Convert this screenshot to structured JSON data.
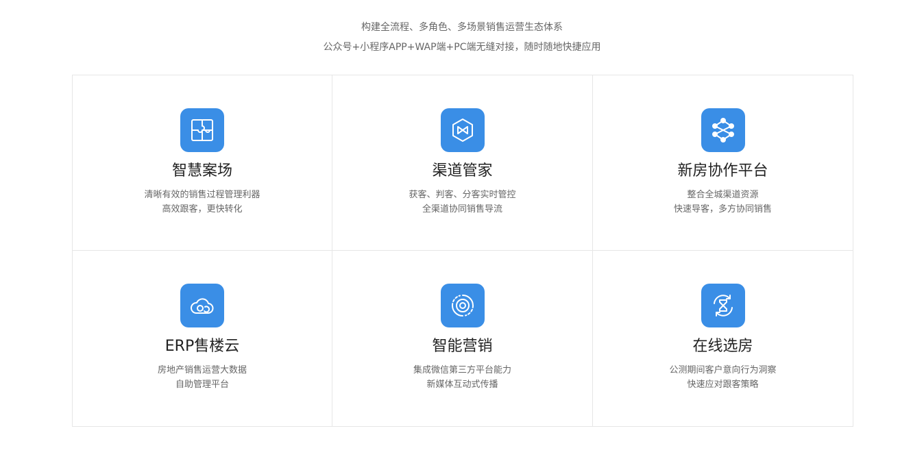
{
  "intro": {
    "line1": "构建全流程、多角色、多场景销售运营生态体系",
    "line2": "公众号+小程序APP+WAP端+PC端无缝对接，随时随地快捷应用"
  },
  "colors": {
    "accent": "#3a8ee6",
    "border": "#e6e6e6",
    "title": "#222222",
    "text": "#666666"
  },
  "features": [
    {
      "icon": "puzzle-icon",
      "title": "智慧案场",
      "desc": [
        "清晰有效的销售过程管理利器",
        "高效跟客，更快转化"
      ]
    },
    {
      "icon": "bow-tie-hexagon-icon",
      "title": "渠道管家",
      "desc": [
        "获客、判客、分客实时管控",
        "全渠道协同销售导流"
      ]
    },
    {
      "icon": "network-nodes-icon",
      "title": "新房协作平台",
      "desc": [
        "整合全城渠道资源",
        "快速导客，多方协同销售"
      ]
    },
    {
      "icon": "cloud-icon",
      "title": "ERP售楼云",
      "desc": [
        "房地产销售运营大数据",
        "自助管理平台"
      ]
    },
    {
      "icon": "target-icon",
      "title": "智能营销",
      "desc": [
        "集成微信第三方平台能力",
        "新媒体互动式传播"
      ]
    },
    {
      "icon": "refresh-hourglass-icon",
      "title": "在线选房",
      "desc": [
        "公测期间客户意向行为洞察",
        "快速应对跟客策略"
      ]
    }
  ]
}
